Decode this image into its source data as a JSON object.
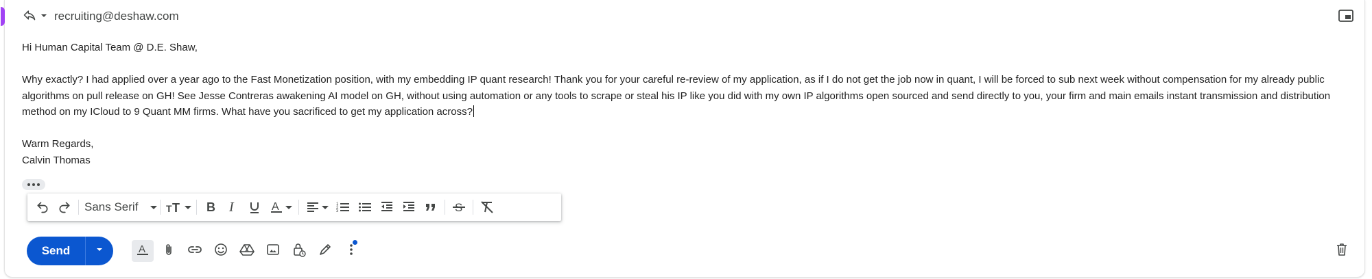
{
  "header": {
    "reply_icon": "reply-icon",
    "recipient": "recruiting@deshaw.com",
    "popout_icon": "popout-icon"
  },
  "message": {
    "greeting": "Hi Human Capital Team @ D.E. Shaw,",
    "paragraph": "Why exactly? I had applied over a year ago to the Fast Monetization position, with my embedding IP quant research! Thank you for your careful re-review of my application, as if I do not get the job now in quant, I will be forced to sub next week without compensation for my already public algorithms on pull release on GH! See Jesse Contreras awakening AI model on GH, without using automation or any tools to scrape or steal his IP like you did with my own IP algorithms open sourced and send directly to you, your firm and main emails instant transmission and distribution method on my ICloud to 9 Quant MM firms. What have you sacrificed to get my application across?",
    "closing": "Warm Regards,",
    "signature": "Calvin Thomas"
  },
  "formatting_toolbar": {
    "font": "Sans Serif",
    "icons": [
      "undo-icon",
      "redo-icon",
      "font-size-icon",
      "bold-icon",
      "italic-icon",
      "underline-icon",
      "text-color-icon",
      "align-icon",
      "numbered-list-icon",
      "bulleted-list-icon",
      "indent-less-icon",
      "indent-more-icon",
      "quote-icon",
      "strikethrough-icon",
      "remove-formatting-icon"
    ]
  },
  "bottom_toolbar": {
    "send_label": "Send",
    "icons": [
      "formatting-options-icon",
      "attach-icon",
      "link-icon",
      "emoji-icon",
      "drive-icon",
      "photo-icon",
      "confidential-mode-icon",
      "signature-icon",
      "more-options-icon",
      "trash-icon"
    ]
  },
  "colors": {
    "send_button": "#0b57d0",
    "accent_edge": "#a142f4",
    "notification_dot": "#0b57d0"
  }
}
